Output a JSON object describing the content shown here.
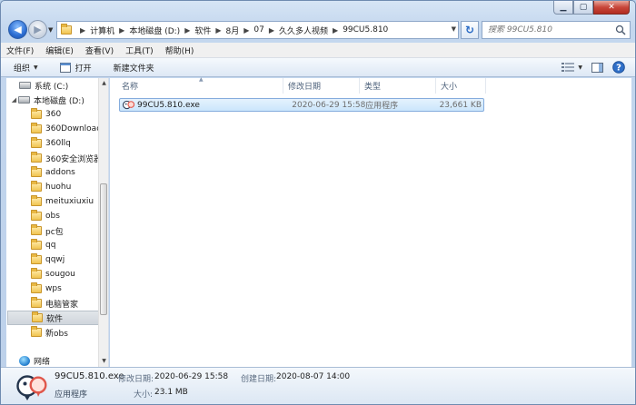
{
  "address": {
    "crumbs": [
      "计算机",
      "本地磁盘 (D:)",
      "软件",
      "8月",
      "07",
      "久久多人视频",
      "99CU5.810"
    ]
  },
  "search": {
    "placeholder": "搜索 99CU5.810"
  },
  "menu": [
    "文件(F)",
    "编辑(E)",
    "查看(V)",
    "工具(T)",
    "帮助(H)"
  ],
  "toolbar": {
    "organize": "组织",
    "open": "打开",
    "new_folder": "新建文件夹"
  },
  "sidebar": {
    "items": [
      {
        "label": "系统 (C:)",
        "kind": "drive"
      },
      {
        "label": "本地磁盘 (D:)",
        "kind": "drive",
        "expanded": true
      },
      {
        "label": "360",
        "kind": "folder"
      },
      {
        "label": "360Downloads",
        "kind": "folder"
      },
      {
        "label": "360llq",
        "kind": "folder"
      },
      {
        "label": "360安全浏览器下",
        "kind": "folder"
      },
      {
        "label": "addons",
        "kind": "folder"
      },
      {
        "label": "huohu",
        "kind": "folder"
      },
      {
        "label": "meituxiuxiu",
        "kind": "folder"
      },
      {
        "label": "obs",
        "kind": "folder"
      },
      {
        "label": "pc包",
        "kind": "folder"
      },
      {
        "label": "qq",
        "kind": "folder"
      },
      {
        "label": "qqwj",
        "kind": "folder"
      },
      {
        "label": "sougou",
        "kind": "folder"
      },
      {
        "label": "wps",
        "kind": "folder"
      },
      {
        "label": "电脑管家",
        "kind": "folder"
      },
      {
        "label": "软件",
        "kind": "folder",
        "selected": true
      },
      {
        "label": "新obs",
        "kind": "folder"
      }
    ],
    "network": "网络"
  },
  "columns": {
    "name": "名称",
    "modified": "修改日期",
    "type": "类型",
    "size": "大小"
  },
  "files": [
    {
      "name": "99CU5.810.exe",
      "modified": "2020-06-29 15:58",
      "type": "应用程序",
      "size": "23,661 KB"
    }
  ],
  "details": {
    "name": "99CU5.810.exe",
    "type": "应用程序",
    "modified_label": "修改日期:",
    "modified_value": "2020-06-29 15:58",
    "created_label": "创建日期:",
    "created_value": "2020-08-07 14:00",
    "size_label": "大小:",
    "size_value": "23.1 MB"
  }
}
